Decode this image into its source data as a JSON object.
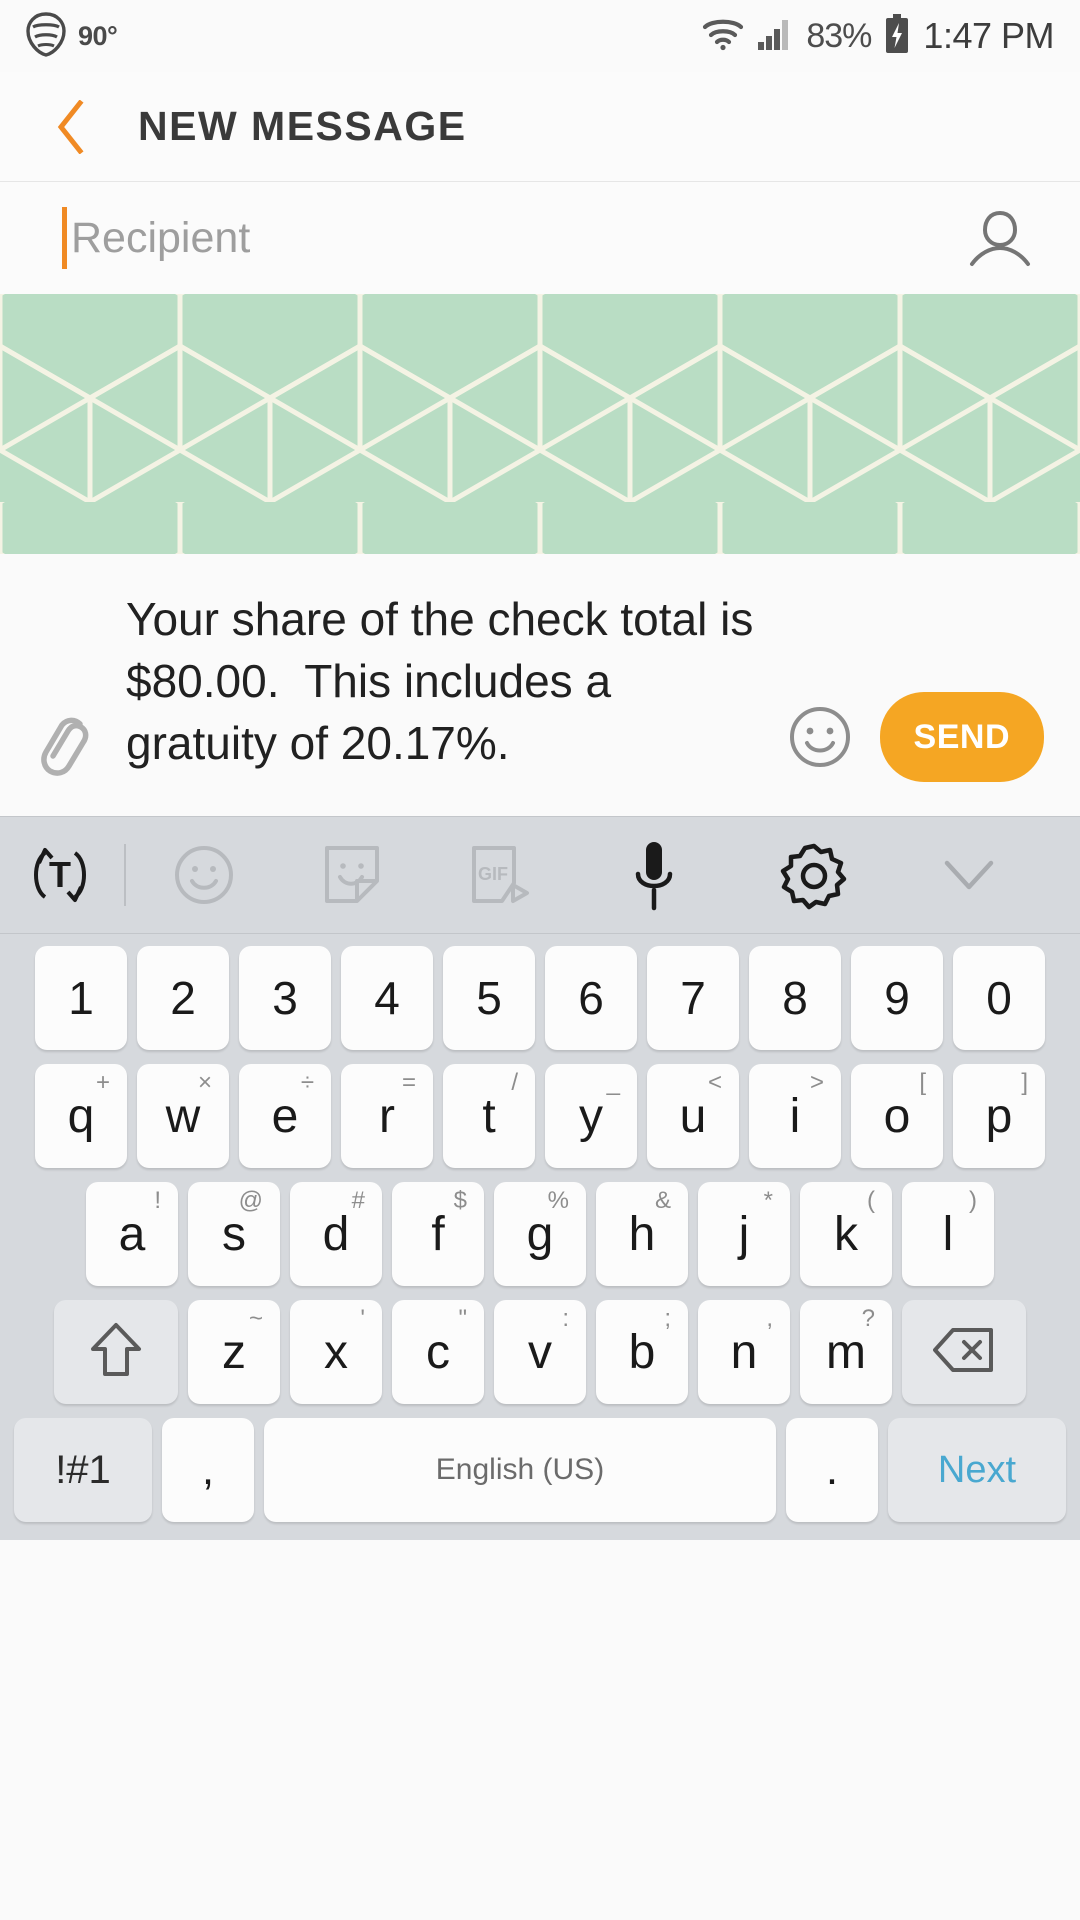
{
  "statusbar": {
    "weather_icon": "weather-signal-icon",
    "temperature": "90°",
    "wifi_icon": "wifi-icon",
    "signal_icon": "cellular-signal-icon",
    "battery_percent": "83%",
    "battery_icon": "battery-charging-icon",
    "time": "1:47 PM"
  },
  "header": {
    "back_icon": "back-chevron-icon",
    "title": "NEW MESSAGE",
    "accent_color": "#f08a24"
  },
  "recipient": {
    "value": "",
    "placeholder": "Recipient",
    "contact_icon": "contact-person-icon",
    "caret_color": "#f08a24"
  },
  "attachment_preview": {
    "type": "image-attachment",
    "description": "isometric-cube-pattern",
    "background_color": "#b9ddc4",
    "line_color": "#f4f3e4"
  },
  "compose": {
    "attach_icon": "paperclip-icon",
    "message_text": "Your share of the check total is $80.00.  This includes a gratuity of 20.17%.",
    "emoji_icon": "smiley-face-icon",
    "send_label": "SEND",
    "send_color": "#f5a623"
  },
  "keyboard_toolbar": {
    "items": [
      {
        "name": "translate-icon",
        "label": "T"
      },
      {
        "name": "emoji-icon",
        "label": ""
      },
      {
        "name": "sticker-icon",
        "label": ""
      },
      {
        "name": "gif-icon",
        "label": "GIF"
      },
      {
        "name": "microphone-icon",
        "label": ""
      },
      {
        "name": "settings-gear-icon",
        "label": ""
      },
      {
        "name": "chevron-down-icon",
        "label": ""
      }
    ]
  },
  "keyboard": {
    "number_row": [
      "1",
      "2",
      "3",
      "4",
      "5",
      "6",
      "7",
      "8",
      "9",
      "0"
    ],
    "row1": [
      {
        "key": "q",
        "sup": "+"
      },
      {
        "key": "w",
        "sup": "×"
      },
      {
        "key": "e",
        "sup": "÷"
      },
      {
        "key": "r",
        "sup": "="
      },
      {
        "key": "t",
        "sup": "/"
      },
      {
        "key": "y",
        "sup": "_"
      },
      {
        "key": "u",
        "sup": "<"
      },
      {
        "key": "i",
        "sup": ">"
      },
      {
        "key": "o",
        "sup": "["
      },
      {
        "key": "p",
        "sup": "]"
      }
    ],
    "row2": [
      {
        "key": "a",
        "sup": "!"
      },
      {
        "key": "s",
        "sup": "@"
      },
      {
        "key": "d",
        "sup": "#"
      },
      {
        "key": "f",
        "sup": "$"
      },
      {
        "key": "g",
        "sup": "%"
      },
      {
        "key": "h",
        "sup": "&"
      },
      {
        "key": "j",
        "sup": "*"
      },
      {
        "key": "k",
        "sup": "("
      },
      {
        "key": "l",
        "sup": ")"
      }
    ],
    "row3": [
      {
        "key": "z",
        "sup": "~"
      },
      {
        "key": "x",
        "sup": "'"
      },
      {
        "key": "c",
        "sup": "\""
      },
      {
        "key": "v",
        "sup": ":"
      },
      {
        "key": "b",
        "sup": ";"
      },
      {
        "key": "n",
        "sup": ","
      },
      {
        "key": "m",
        "sup": "?"
      }
    ],
    "shift_icon": "shift-arrow-icon",
    "backspace_icon": "backspace-icon",
    "symbols_label": "!#1",
    "comma_label": ",",
    "space_label": "English (US)",
    "period_label": ".",
    "next_label": "Next",
    "next_color": "#49a8d0"
  }
}
